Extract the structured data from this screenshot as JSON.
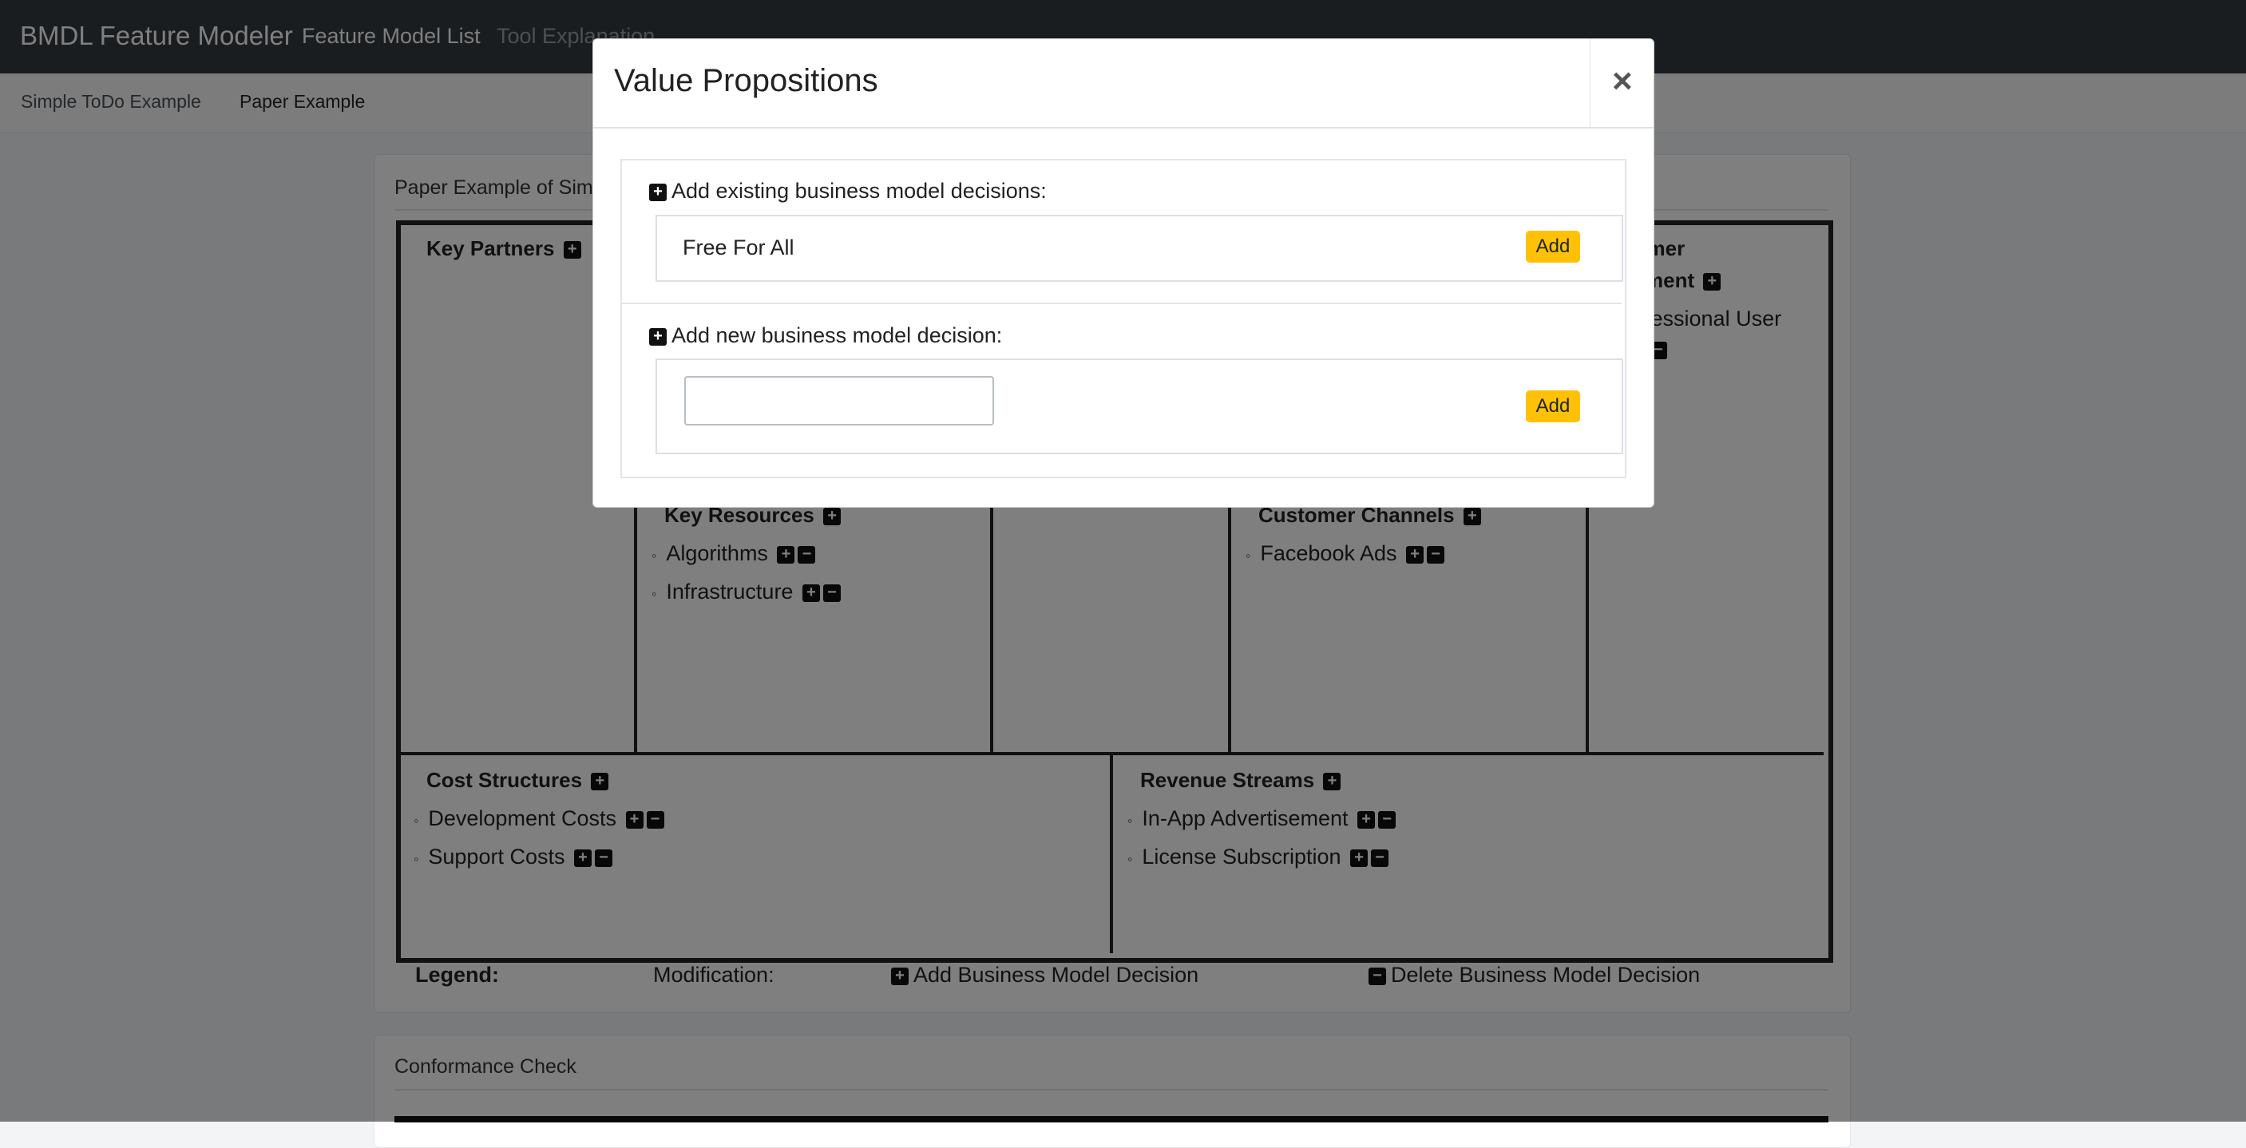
{
  "navbar": {
    "brand": "BMDL Feature Modeler",
    "links": [
      "Feature Model List",
      "Tool Explanation"
    ]
  },
  "subnav": {
    "links": [
      "Simple ToDo Example",
      "Paper Example"
    ]
  },
  "main": {
    "card_title": "Paper Example of Sim",
    "blocks": {
      "key_partners": {
        "title": "Key Partners"
      },
      "key_resources": {
        "title": "Key Resources",
        "items": [
          "Algorithms",
          "Infrastructure"
        ]
      },
      "customer_channels": {
        "title": "Customer Channels",
        "items": [
          "Facebook Ads"
        ]
      },
      "customer_segment": {
        "title_line1": "tomer",
        "title_line2": "ment",
        "items": [
          "fessional User"
        ]
      },
      "cost_structures": {
        "title": "Cost Structures",
        "items": [
          "Development Costs",
          "Support Costs"
        ]
      },
      "revenue_streams": {
        "title": "Revenue Streams",
        "items": [
          "In-App Advertisement",
          "License Subscription"
        ]
      }
    },
    "legend": {
      "label": "Legend:",
      "modification": "Modification:",
      "add": "Add Business Model Decision",
      "delete": "Delete Business Model Decision"
    },
    "conformance_title": "Conformance Check"
  },
  "modal": {
    "title": "Value Propositions",
    "close": "×",
    "existing_label": "Add existing business model decisions:",
    "existing_item": "Free For All",
    "new_label": "Add new business model decision:",
    "new_input_value": "",
    "add_label": "Add"
  },
  "colors": {
    "navbar": "#343a40",
    "add_button": "#ffc107"
  }
}
